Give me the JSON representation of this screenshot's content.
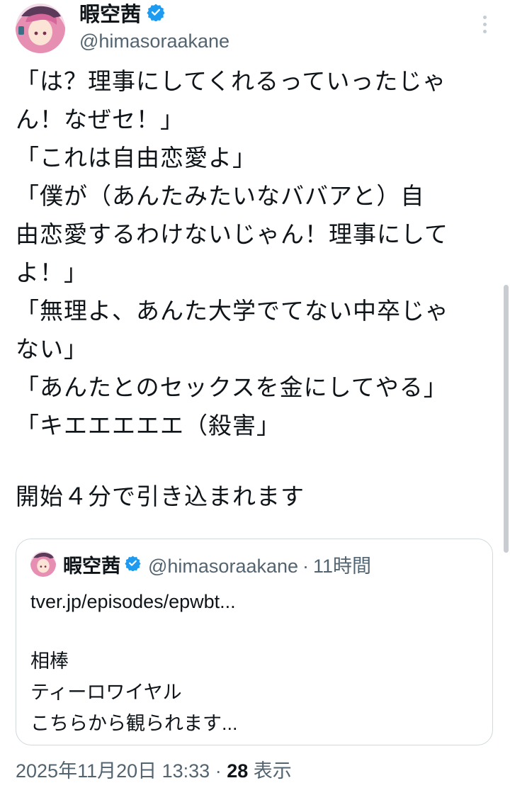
{
  "author": {
    "display_name": "暇空茜",
    "handle": "@himasoraakane"
  },
  "tweet": {
    "lines": [
      "「は？理事にしてくれるっていったじゃ",
      "ん！なぜセ！」",
      "「これは自由恋愛よ」",
      "「僕が（あんたみたいなババアと）自",
      "由恋愛するわけないじゃん！理事にして",
      "よ！」",
      "「無理よ、あんた大学でてない中卒じゃ",
      "ない」",
      "「あんたとのセックスを金にしてやる」",
      "「キエエエエエ（殺害」",
      "",
      "開始４分で引き込まれます"
    ]
  },
  "quote": {
    "display_name": "暇空茜",
    "handle": "@himasoraakane",
    "separator": "·",
    "time": "11時間",
    "lines": [
      "tver.jp/episodes/epwbt...",
      "",
      "相棒",
      "ティーロワイヤル",
      "こちらから観られます..."
    ]
  },
  "meta": {
    "timestamp": "2025年11月20日 13:33",
    "separator": "·",
    "views_count": "28",
    "views_label": "表示"
  },
  "colors": {
    "verified_badge": "#1d9bf0",
    "text_primary": "#0f1419",
    "text_secondary": "#536471",
    "border": "#cfd9de"
  },
  "icons": {
    "verified": "verified-badge-icon",
    "more": "more-vertical-icon"
  }
}
